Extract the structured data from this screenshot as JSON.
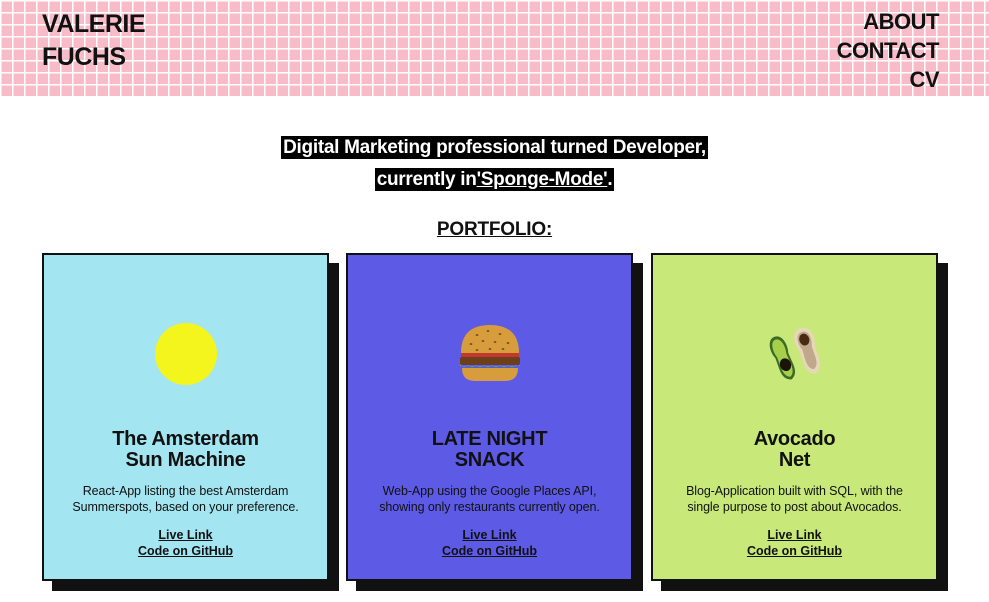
{
  "header": {
    "name_line1": "VALERIE",
    "name_line2": "FUCHS",
    "nav": [
      {
        "label": "ABOUT"
      },
      {
        "label": "CONTACT"
      },
      {
        "label": "CV"
      }
    ]
  },
  "tagline": {
    "line1": "Digital Marketing professional turned Developer,",
    "line2_prefix": "currently in",
    "line2_mode": "'Sponge-Mode'",
    "line2_suffix": "."
  },
  "portfolio": {
    "title": "PORTFOLIO:",
    "projects": [
      {
        "icon": "sun-icon",
        "title_line1": "The Amsterdam",
        "title_line2": "Sun Machine",
        "desc_line1": "React-App listing the best Amsterdam",
        "desc_line2": "Summerspots, based on your preference.",
        "live_link": "Live Link",
        "github_link": "Code on GitHub",
        "color": "#a3e6f1"
      },
      {
        "icon": "burger-icon",
        "title_line1": "LATE NIGHT",
        "title_line2": "SNACK",
        "desc_line1": "Web-App using the Google Places API,",
        "desc_line2": "showing only restaurants currently open.",
        "live_link": "Live Link",
        "github_link": "Code on GitHub",
        "color": "#5d5ae6"
      },
      {
        "icon": "avocado-icon",
        "title_line1": "Avocado",
        "title_line2": "Net",
        "desc_line1": "Blog-Application built with SQL, with the",
        "desc_line2": "single purpose to post about Avocados.",
        "live_link": "Live Link",
        "github_link": "Code on GitHub",
        "color": "#c8e87a"
      }
    ]
  },
  "colors": {
    "header_pink": "#f8bcc8",
    "sun_yellow": "#f4f51c",
    "text": "#111111"
  }
}
